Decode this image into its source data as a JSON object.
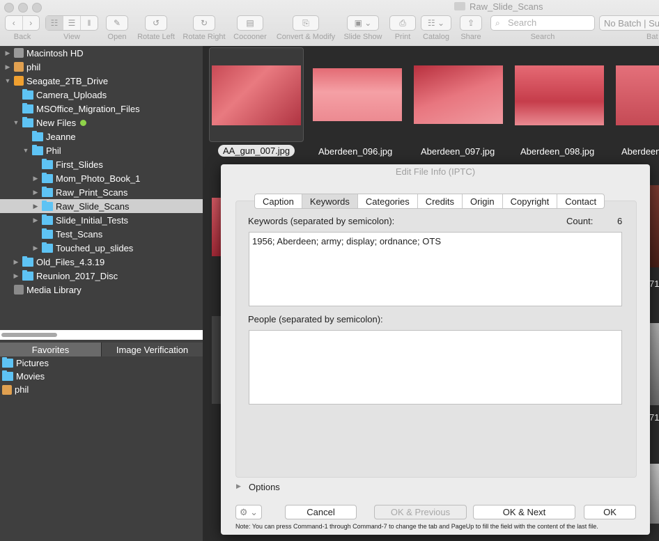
{
  "window": {
    "title": "Raw_Slide_Scans"
  },
  "toolbar": {
    "back": "Back",
    "view": "View",
    "open": "Open",
    "rotate_left": "Rotate Left",
    "rotate_right": "Rotate Right",
    "cocooner": "Cocooner",
    "convert": "Convert & Modify",
    "slideshow": "Slide Show",
    "print": "Print",
    "catalog": "Catalog",
    "share": "Share",
    "search_label": "Search",
    "search_placeholder": "Search",
    "batch_value": "No Batch | Su",
    "batch_label": "Bat"
  },
  "sidebar": {
    "tree": [
      {
        "label": "Macintosh HD"
      },
      {
        "label": "phil"
      },
      {
        "label": "Seagate_2TB_Drive"
      },
      {
        "label": "Camera_Uploads"
      },
      {
        "label": "MSOffice_Migration_Files"
      },
      {
        "label": "New Files"
      },
      {
        "label": "Jeanne"
      },
      {
        "label": "Phil"
      },
      {
        "label": "First_Slides"
      },
      {
        "label": "Mom_Photo_Book_1"
      },
      {
        "label": "Raw_Print_Scans"
      },
      {
        "label": "Raw_Slide_Scans"
      },
      {
        "label": "Slide_Initial_Tests"
      },
      {
        "label": "Test_Scans"
      },
      {
        "label": "Touched_up_slides"
      },
      {
        "label": "Old_Files_4.3.19"
      },
      {
        "label": "Reunion_2017_Disc"
      },
      {
        "label": "Media Library"
      }
    ],
    "tabs": [
      "Favorites",
      "Image Verification"
    ],
    "favorites": [
      "Pictures",
      "Movies",
      "phil"
    ]
  },
  "thumbnails": [
    {
      "name": "AA_gun_007.jpg"
    },
    {
      "name": "Aberdeen_096.jpg"
    },
    {
      "name": "Aberdeen_097.jpg"
    },
    {
      "name": "Aberdeen_098.jpg"
    },
    {
      "name": "Aberdeen"
    }
  ],
  "dialog": {
    "title": "Edit File Info (IPTC)",
    "tabs": [
      "Caption",
      "Keywords",
      "Categories",
      "Credits",
      "Origin",
      "Copyright",
      "Contact"
    ],
    "keywords_label": "Keywords (separated by semicolon):",
    "count_label": "Count:",
    "count_value": "6",
    "keywords_value": "1956; Aberdeen; army; display; ordnance; OTS",
    "people_label": "People (separated by semicolon):",
    "people_value": "",
    "options_label": "Options",
    "buttons": {
      "cancel": "Cancel",
      "ok_previous": "OK & Previous",
      "ok_next": "OK & Next",
      "ok": "OK"
    },
    "note": "Note: You can press Command-1 through Command-7 to change the tab and PageUp to fill the field with the content of the last file."
  },
  "partial_labels": {
    "a": "71",
    "b": "71"
  }
}
